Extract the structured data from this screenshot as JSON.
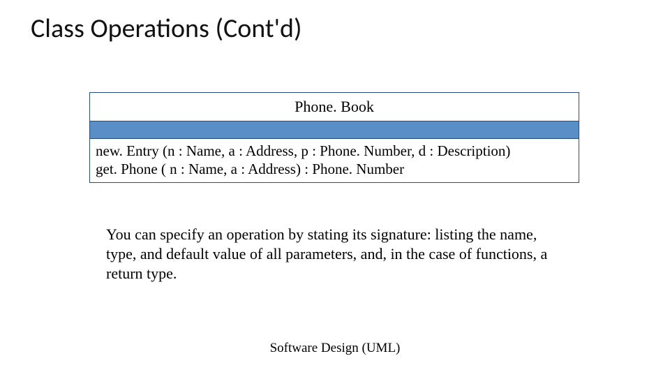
{
  "slide": {
    "title": "Class Operations (Cont'd)",
    "footer": "Software Design (UML)"
  },
  "uml": {
    "class_name": "Phone. Book",
    "operations": {
      "op1": "new. Entry (n : Name, a : Address, p : Phone. Number, d : Description)",
      "op2": "get. Phone ( n : Name, a : Address) : Phone. Number"
    }
  },
  "body": {
    "explain": "You can specify an operation by stating its signature: listing the name, type, and default value of all parameters, and, in the case of functions, a return type."
  }
}
